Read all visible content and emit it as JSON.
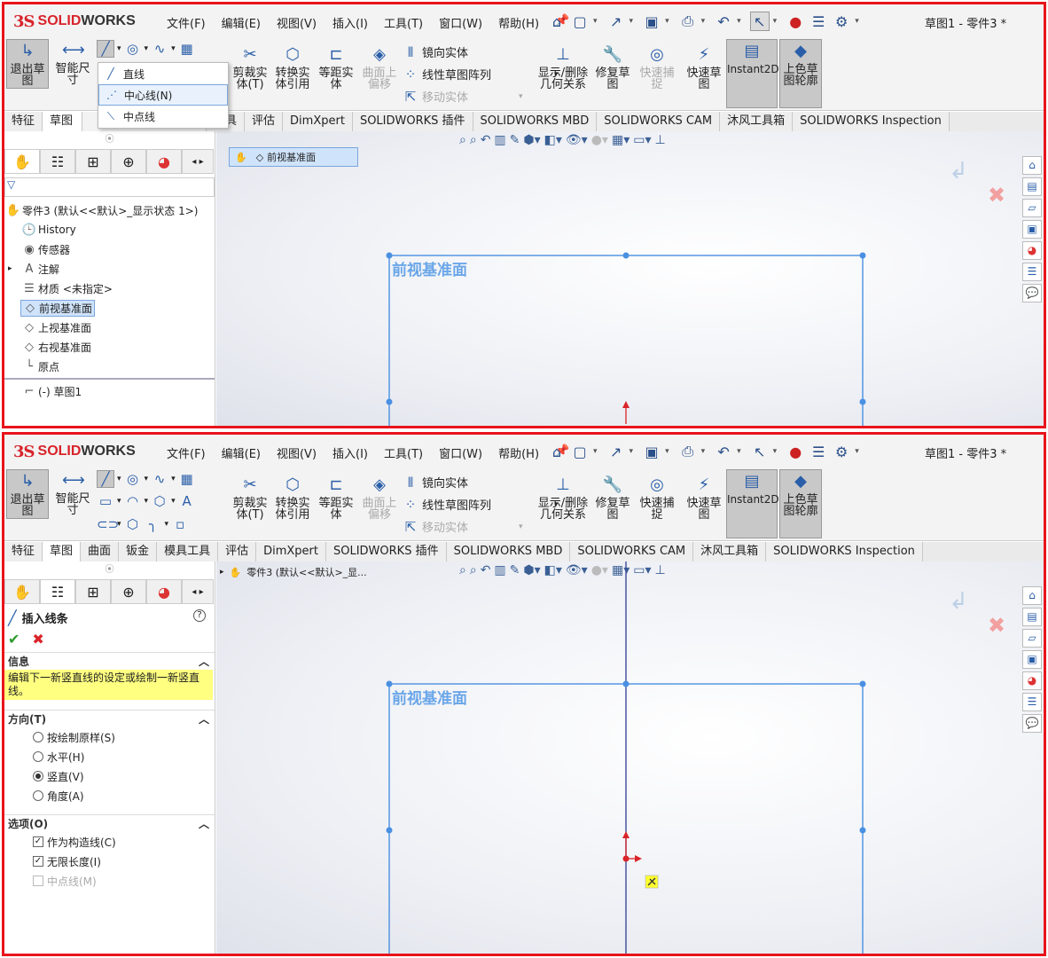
{
  "app": {
    "brand_ds": "3S",
    "brand_solid": "SOLID",
    "brand_works": "WORKS",
    "menu": [
      "文件(F)",
      "编辑(E)",
      "视图(V)",
      "插入(I)",
      "工具(T)",
      "窗口(W)",
      "帮助(H)"
    ],
    "doc_title": "草图1 - 零件3 *"
  },
  "ribbon": {
    "exit_sketch": "退出草图",
    "smart_dim": "智能尺寸",
    "trim": "剪裁实体(T)",
    "convert": "转换实体引用",
    "offset": "等距实体",
    "offset_surface": "曲面上偏移",
    "mirror": "镜向实体",
    "linear_pattern": "线性草图阵列",
    "move": "移动实体",
    "display_relations": "显示/删除几何关系",
    "repair": "修复草图",
    "quick_snap": "快速捕捉",
    "rapid_sketch": "快速草图",
    "instant2d": "Instant2D",
    "shaded_contours": "上色草图轮廓"
  },
  "line_dropdown": {
    "items": [
      "直线",
      "中心线(N)",
      "中点线"
    ]
  },
  "tabs_top": [
    "特征",
    "草图",
    "工具",
    "评估",
    "DimXpert",
    "SOLIDWORKS 插件",
    "SOLIDWORKS MBD",
    "SOLIDWORKS CAM",
    "沐风工具箱",
    "SOLIDWORKS Inspection"
  ],
  "tabs_bottom": [
    "特征",
    "草图",
    "曲面",
    "钣金",
    "模具工具",
    "评估",
    "DimXpert",
    "SOLIDWORKS 插件",
    "SOLIDWORKS MBD",
    "SOLIDWORKS CAM",
    "沐风工具箱",
    "SOLIDWORKS Inspection"
  ],
  "tree": {
    "root": "零件3 (默认<<默认>_显示状态 1>)",
    "items": [
      "History",
      "传感器",
      "注解",
      "材质 <未指定>",
      "前视基准面",
      "上视基准面",
      "右视基准面",
      "原点",
      "(-) 草图1"
    ]
  },
  "breadcrumb": {
    "plane": "前视基准面",
    "part_short": "零件3 (默认<<默认>_显..."
  },
  "plane_label": "前视基准面",
  "pm": {
    "title": "插入线条",
    "info_header": "信息",
    "info_text": "编辑下一新竖直线的设定或绘制一新竖直线。",
    "direction_header": "方向(T)",
    "options": [
      "按绘制原样(S)",
      "水平(H)",
      "竖直(V)",
      "角度(A)"
    ],
    "selected_option": "竖直(V)",
    "opts_header": "选项(O)",
    "checks": [
      "作为构造线(C)",
      "无限长度(I)",
      "中点线(M)"
    ]
  },
  "colors": {
    "frame": "#e8141c",
    "sketch": "#4a90e2",
    "construction": "#3d4a9a",
    "label": "#6aa6e8"
  }
}
